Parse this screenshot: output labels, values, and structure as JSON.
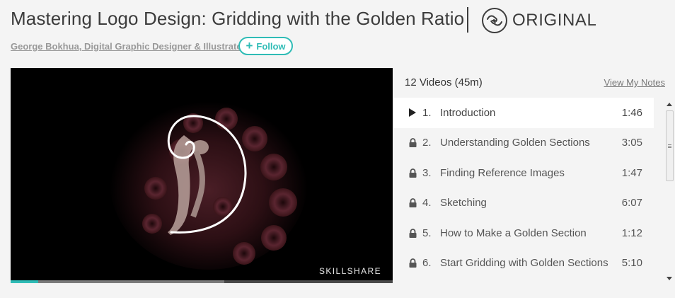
{
  "header": {
    "title": "Mastering Logo Design: Gridding with the Golden Ratio",
    "badge_label": "ORIGINAL",
    "badge_icon": "handshake-icon",
    "author": "George Bokhua, Digital Graphic Designer & Illustrator",
    "follow_label": "Follow",
    "follow_icon": "plus-icon",
    "accent_color": "#2fbcb6"
  },
  "video": {
    "watermark": "SKILLSHARE",
    "played_fraction": 0.072,
    "buffered_fraction": 0.56
  },
  "playlist": {
    "count_label": "12 Videos (45m)",
    "notes_label": "View My Notes",
    "lessons": [
      {
        "num": "1.",
        "title": "Introduction",
        "duration": "1:46",
        "state": "playing"
      },
      {
        "num": "2.",
        "title": "Understanding Golden Sections",
        "duration": "3:05",
        "state": "locked"
      },
      {
        "num": "3.",
        "title": "Finding Reference Images",
        "duration": "1:47",
        "state": "locked"
      },
      {
        "num": "4.",
        "title": "Sketching",
        "duration": "6:07",
        "state": "locked"
      },
      {
        "num": "5.",
        "title": "How to Make a Golden Section",
        "duration": "1:12",
        "state": "locked"
      },
      {
        "num": "6.",
        "title": "Start Gridding with Golden Sections",
        "duration": "5:10",
        "state": "locked"
      }
    ]
  }
}
